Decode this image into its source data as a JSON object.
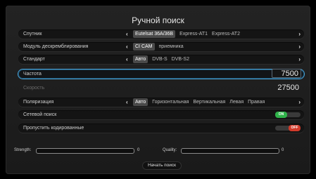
{
  "title": "Ручной поиск",
  "rows": [
    {
      "label": "Спутник",
      "options": [
        "Eutelsat 36A/36B",
        "Express-AT1",
        "Express-AT2"
      ],
      "selected": 0
    },
    {
      "label": "Модуль дескремблирования",
      "options": [
        "CI CAM",
        "приемника"
      ],
      "selected": 0
    },
    {
      "label": "Стандарт",
      "options": [
        "Авто",
        "DVB-S",
        "DVB-S2"
      ],
      "selected": 0
    },
    {
      "label": "Частота",
      "value": "7500"
    },
    {
      "label": "Скорость",
      "value": "27500"
    },
    {
      "label": "Поляризация",
      "options": [
        "Авто",
        "Горизонтальная",
        "Вертикальная",
        "Левая",
        "Правая"
      ],
      "selected": 0
    },
    {
      "label": "Сетевой поиск",
      "toggle": "ON"
    },
    {
      "label": "Пропустить кодированные",
      "toggle": "OFF"
    }
  ],
  "strength": {
    "label": "Strength:",
    "value": "0"
  },
  "quality": {
    "label": "Quality:",
    "value": "0"
  },
  "start_button": "Начать поиск",
  "colors": {
    "focus": "#4aa3d8",
    "toggle_on": "#2fb34a",
    "toggle_off": "#d23a2a"
  }
}
